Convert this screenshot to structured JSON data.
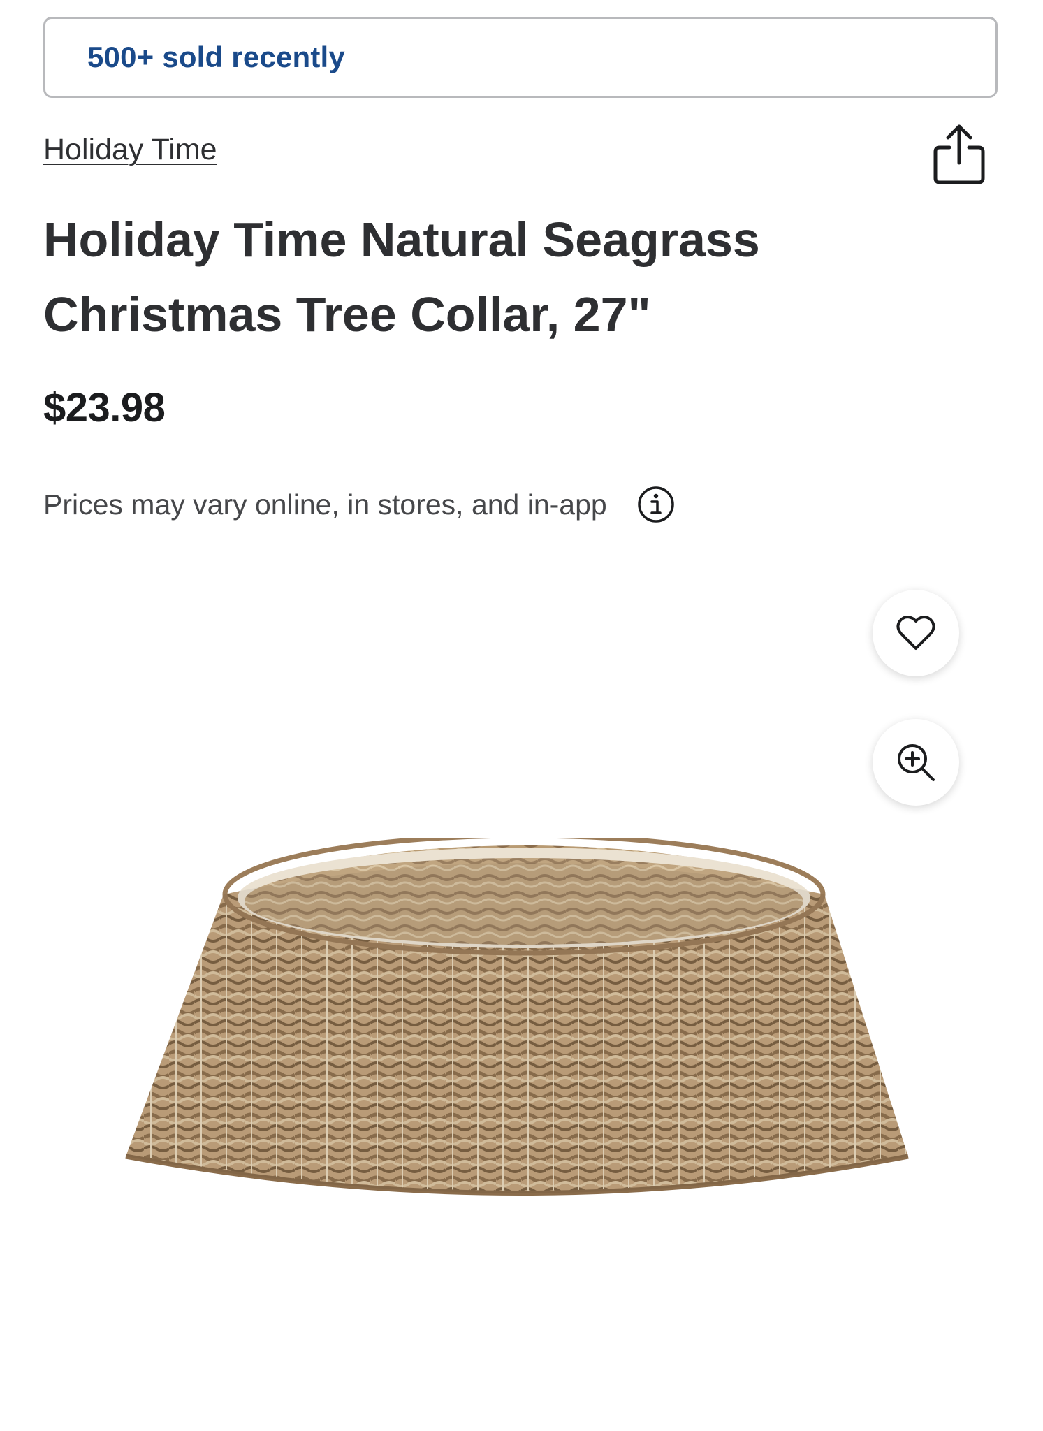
{
  "banner": {
    "sold_text": "500+ sold recently"
  },
  "product": {
    "brand": "Holiday Time",
    "title": "Holiday Time Natural Seagrass Christmas Tree Collar, 27\"",
    "price": "$23.98",
    "price_note": "Prices may vary online, in stores, and in-app",
    "image_alt": "Natural seagrass woven Christmas tree collar"
  },
  "icons": {
    "share": "share-icon",
    "info": "info-icon",
    "favorite": "heart-icon",
    "zoom": "zoom-in-icon"
  },
  "colors": {
    "sold_text": "#1a4a8a",
    "text": "#2e2f32",
    "border": "#b8b9bc",
    "basket": "#c4a57f"
  }
}
